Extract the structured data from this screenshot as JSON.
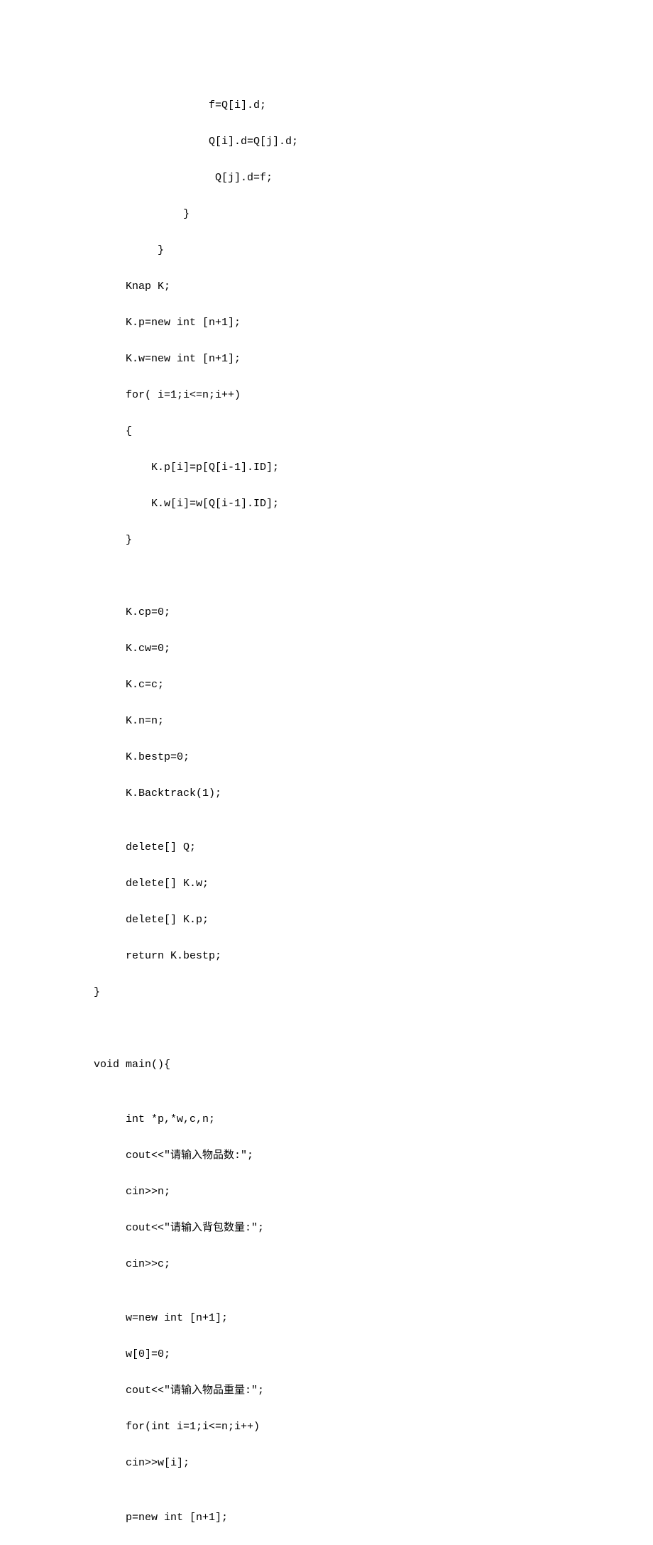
{
  "code": {
    "lines": [
      "                  f=Q[i].d;",
      "                  Q[i].d=Q[j].d;",
      "                   Q[j].d=f;",
      "              }",
      "          }",
      "     Knap K;",
      "     K.p=new int [n+1];",
      "     K.w=new int [n+1];",
      "     for( i=1;i<=n;i++)",
      "     {",
      "         K.p[i]=p[Q[i-1].ID];",
      "         K.w[i]=w[Q[i-1].ID];",
      "     }",
      "",
      "",
      "     K.cp=0;",
      "     K.cw=0;",
      "     K.c=c;",
      "     K.n=n;",
      "     K.bestp=0;",
      "     K.Backtrack(1);",
      "",
      "     delete[] Q;",
      "     delete[] K.w;",
      "     delete[] K.p;",
      "     return K.bestp;",
      "}",
      "",
      "",
      "void main(){",
      "",
      "     int *p,*w,c,n;",
      "     cout<<\"请输入物品数:\";",
      "     cin>>n;",
      "     cout<<\"请输入背包数量:\";",
      "     cin>>c;",
      "",
      "     w=new int [n+1];",
      "     w[0]=0;",
      "     cout<<\"请输入物品重量:\";",
      "     for(int i=1;i<=n;i++)",
      "     cin>>w[i];",
      "",
      "     p=new int [n+1];"
    ]
  }
}
